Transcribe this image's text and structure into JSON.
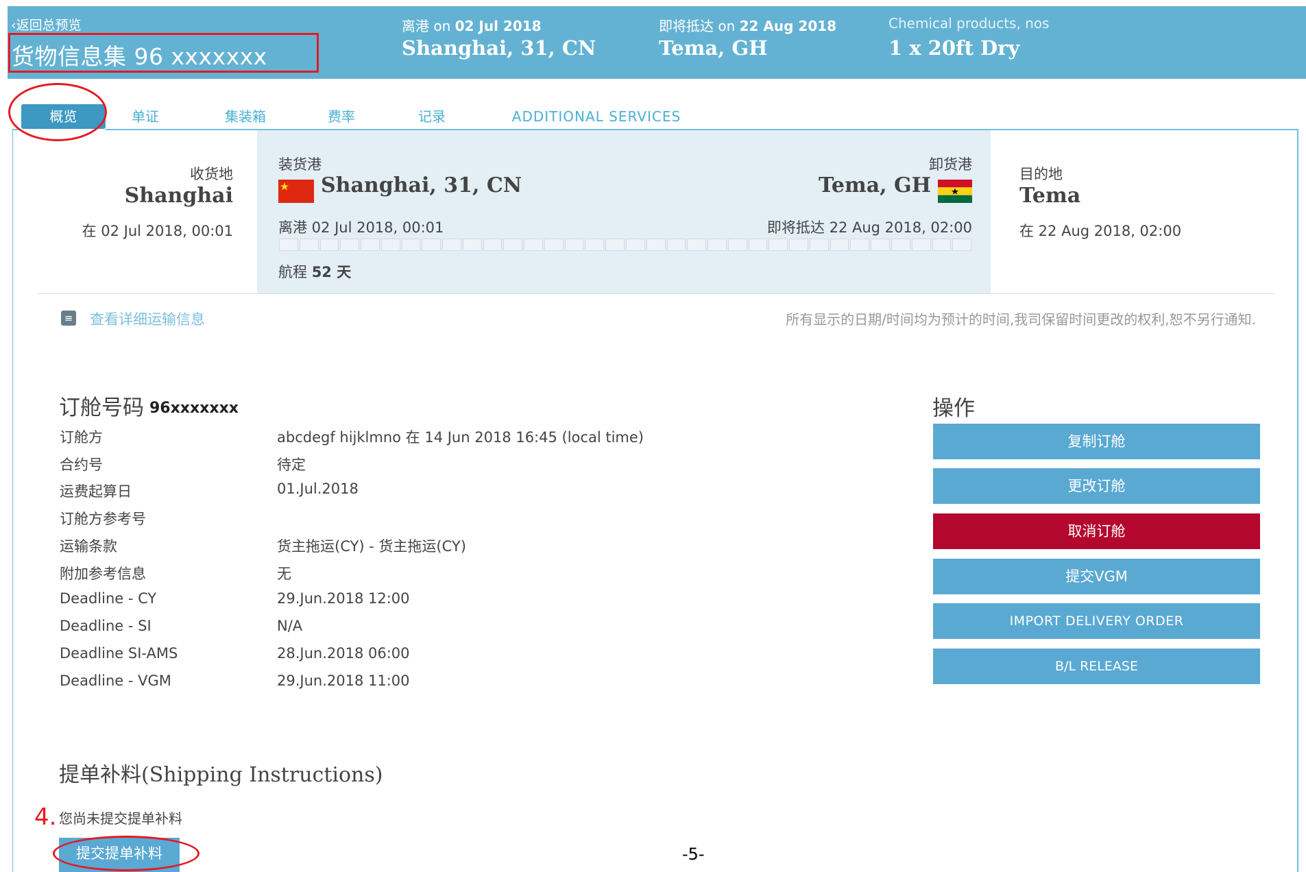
{
  "header": {
    "back_link": "‹返回总预览",
    "booking_title": "货物信息集 96 xxxxxxx",
    "departure_prefix": "离港 on",
    "departure_date": "02 Jul 2018",
    "departure_port": "Shanghai, 31, CN",
    "arrival_prefix": "即将抵达 on",
    "arrival_date": "22 Aug 2018",
    "arrival_port": "Tema, GH",
    "commodity": "Chemical products, nos",
    "equipment": "1 x 20ft Dry"
  },
  "tabs": [
    {
      "label": "概览"
    },
    {
      "label": "单证"
    },
    {
      "label": "集装箱"
    },
    {
      "label": "费率"
    },
    {
      "label": "记录"
    },
    {
      "label": "ADDITIONAL SERVICES"
    }
  ],
  "route": {
    "receipt": {
      "label": "收货地",
      "city": "Shanghai",
      "time": "在 02 Jul 2018, 00:01"
    },
    "load_port": {
      "label": "装货港",
      "city": "Shanghai, 31, CN",
      "departure": "离港 02 Jul 2018, 00:01"
    },
    "discharge_port": {
      "label": "卸货港",
      "city": "Tema, GH",
      "arrival": "即将抵达 22 Aug 2018, 02:00"
    },
    "voyage_label": "航程",
    "voyage_days": "52 天",
    "destination": {
      "label": "目的地",
      "city": "Tema",
      "time": "在 22 Aug 2018, 02:00"
    },
    "progress_fraction": 0
  },
  "details_link": "查看详细运输信息",
  "disclaimer": "所有显示的日期/时间均为预计的时间,我司保留时间更改的权利,恕不另行通知.",
  "booking": {
    "heading": "订舱号码",
    "number": "96xxxxxxx",
    "fields": [
      {
        "key": "订舱方",
        "value": "abcdegf hijklmno 在 14 Jun 2018 16:45 (local time)"
      },
      {
        "key": "合约号",
        "value": "待定"
      },
      {
        "key": "运费起算日",
        "value": "01.Jul.2018"
      },
      {
        "key": "订舱方参考号",
        "value": ""
      },
      {
        "key": "运输条款",
        "value": "货主拖运(CY) - 货主拖运(CY)"
      },
      {
        "key": "附加参考信息",
        "value": "无"
      },
      {
        "key": "Deadline - CY",
        "value": "29.Jun.2018 12:00"
      },
      {
        "key": "Deadline - SI",
        "value": "N/A"
      },
      {
        "key": "Deadline SI-AMS",
        "value": "28.Jun.2018 06:00"
      },
      {
        "key": "Deadline - VGM",
        "value": "29.Jun.2018 11:00"
      }
    ]
  },
  "actions": {
    "heading": "操作",
    "buttons": [
      {
        "label": "复制订舱"
      },
      {
        "label": "更改订舱"
      },
      {
        "label": "取消订舱"
      },
      {
        "label": "提交VGM"
      },
      {
        "label": "IMPORT DELIVERY ORDER"
      },
      {
        "label": "B/L RELEASE"
      }
    ]
  },
  "shipping_instructions": {
    "heading": "提单补料(Shipping Instructions)",
    "note": "您尚未提交提单补料",
    "step_number": "4.",
    "button_label": "提交提单补料"
  },
  "page_number": "-5-",
  "colors": {
    "header_bg": "#64b2d3",
    "accent": "#5aa9d3",
    "danger": "#b3072e",
    "annotation": "#e31b23"
  },
  "icons": [
    "china-flag-icon",
    "ghana-flag-icon",
    "expand-icon"
  ]
}
